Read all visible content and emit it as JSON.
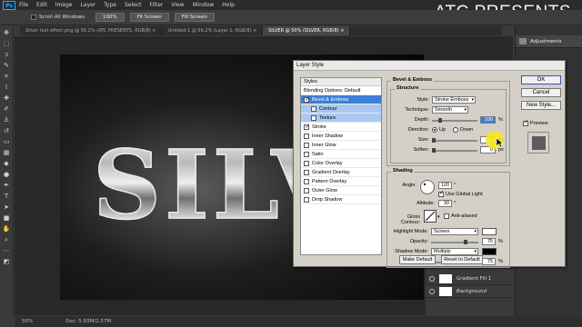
{
  "app": {
    "logo": "Ps"
  },
  "menu": [
    "File",
    "Edit",
    "Image",
    "Layer",
    "Type",
    "Select",
    "Filter",
    "View",
    "Window",
    "Help"
  ],
  "watermark": "ATC PRESENTS",
  "options_bar": {
    "scroll_all_label": "Scroll All Windows",
    "btn_100": "100%",
    "btn_fit": "Fit Screen",
    "btn_fill": "Fill Screen"
  },
  "tabs": [
    {
      "label": "Silver text effect.png @ 56.2% (ATC PRESENTS, RGB/8) ×",
      "active": false
    },
    {
      "label": "Untitled-1 @ 56.2% (Layer 1, RGB/8) ×",
      "active": false
    },
    {
      "label": "SILVER @ 50% (SILVER, RGB/8) ×",
      "active": true
    }
  ],
  "canvas": {
    "text": "SILVER"
  },
  "status": {
    "zoom": "50%",
    "doc": "Doc: 5.93M/2.57M"
  },
  "right_panel": {
    "adjustments_label": "Adjustments"
  },
  "layers": [
    {
      "name": "Gradient Fill 1",
      "thumb_color": "#ffffff"
    },
    {
      "name": "Background",
      "thumb_color": "#ffffff"
    }
  ],
  "dialog": {
    "title": "Layer Style",
    "styles_header": "Styles",
    "blending_options": "Blending Options: Default",
    "styles": [
      {
        "label": "Bevel & Emboss",
        "checked": true,
        "sub": false,
        "state": "selected"
      },
      {
        "label": "Contour",
        "checked": false,
        "sub": true,
        "state": "subsel"
      },
      {
        "label": "Texture",
        "checked": false,
        "sub": true,
        "state": "subsel"
      },
      {
        "label": "Stroke",
        "checked": true,
        "sub": false,
        "state": ""
      },
      {
        "label": "Inner Shadow",
        "checked": false,
        "sub": false,
        "state": ""
      },
      {
        "label": "Inner Glow",
        "checked": false,
        "sub": false,
        "state": ""
      },
      {
        "label": "Satin",
        "checked": false,
        "sub": false,
        "state": ""
      },
      {
        "label": "Color Overlay",
        "checked": false,
        "sub": false,
        "state": ""
      },
      {
        "label": "Gradient Overlay",
        "checked": false,
        "sub": false,
        "state": ""
      },
      {
        "label": "Pattern Overlay",
        "checked": false,
        "sub": false,
        "state": ""
      },
      {
        "label": "Outer Glow",
        "checked": false,
        "sub": false,
        "state": ""
      },
      {
        "label": "Drop Shadow",
        "checked": false,
        "sub": false,
        "state": ""
      }
    ],
    "bevel": {
      "title": "Bevel & Emboss",
      "structure_title": "Structure",
      "style_label": "Style:",
      "style_value": "Stroke Emboss",
      "technique_label": "Technique:",
      "technique_value": "Smooth",
      "depth_label": "Depth:",
      "depth_value": "100",
      "depth_level": 0.15,
      "direction_label": "Direction:",
      "direction_up": "Up",
      "direction_down": "Down",
      "size_label": "Size:",
      "size_value": "0",
      "size_level": 0.0,
      "soften_label": "Soften:",
      "soften_value": "0",
      "soften_level": 0.0,
      "unit_pct": "%",
      "unit_px": "px"
    },
    "shading": {
      "title": "Shading",
      "angle_label": "Angle:",
      "angle_value": "120",
      "use_global_light": "Use Global Light",
      "altitude_label": "Altitude:",
      "altitude_value": "30",
      "gloss_label": "Gloss Contour:",
      "anti_aliased": "Anti-aliased",
      "highlight_mode_label": "Highlight Mode:",
      "highlight_mode_value": "Screen",
      "highlight_color": "#ffffff",
      "highlight_opacity_label": "Opacity:",
      "highlight_opacity": "75",
      "highlight_level": 0.75,
      "shadow_mode_label": "Shadow Mode:",
      "shadow_mode_value": "Multiply",
      "shadow_color": "#000000",
      "shadow_opacity_label": "Opacity:",
      "shadow_opacity": "75",
      "shadow_level": 0.75,
      "unit_deg": "°",
      "unit_pct": "%"
    },
    "make_default": "Make Default",
    "reset_default": "Reset to Default",
    "buttons": {
      "ok": "OK",
      "cancel": "Cancel",
      "new_style": "New Style...",
      "preview": "Preview"
    }
  },
  "colors": {
    "accent": "#3d7fd6",
    "ps_blue": "#31a8ff",
    "cursor_highlight": "#f6e81c"
  }
}
